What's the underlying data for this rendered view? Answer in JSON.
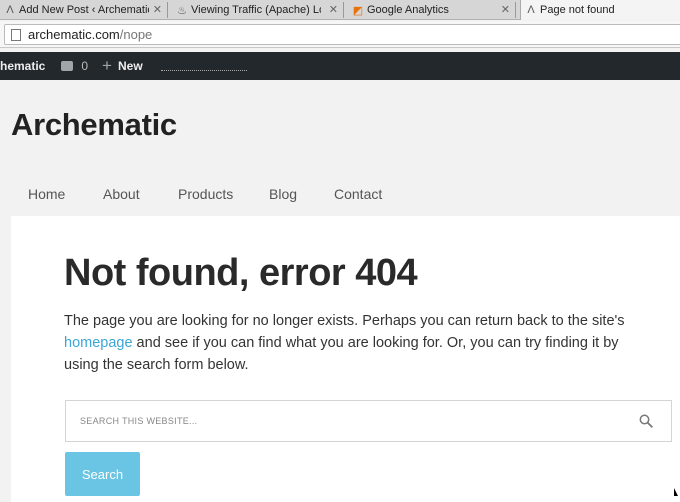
{
  "browser": {
    "tabs": [
      {
        "label": "Add New Post ‹ Archematic",
        "icon": "archematic-favicon"
      },
      {
        "label": "Viewing Traffic (Apache) Lo",
        "icon": "traffic-favicon"
      },
      {
        "label": "Google Analytics",
        "icon": "analytics-favicon"
      },
      {
        "label": "Page not found",
        "icon": "archematic-favicon"
      }
    ],
    "url_host": "archematic.com",
    "url_path": "/nope"
  },
  "adminbar": {
    "site_name": "hematic",
    "comments_count": "0",
    "new_label": "New"
  },
  "site": {
    "title": "Archematic",
    "nav": [
      "Home",
      "About",
      "Products",
      "Blog",
      "Contact"
    ]
  },
  "content": {
    "heading": "Not found, error 404",
    "para_before": "The page you are looking for no longer exists. Perhaps you can return back to the site's ",
    "link_text": "homepage",
    "para_after": " and see if you can find what you are looking for. Or, you can try finding it by using the search form below.",
    "search_placeholder": "SEARCH THIS WEBSITE...",
    "search_button": "Search"
  }
}
